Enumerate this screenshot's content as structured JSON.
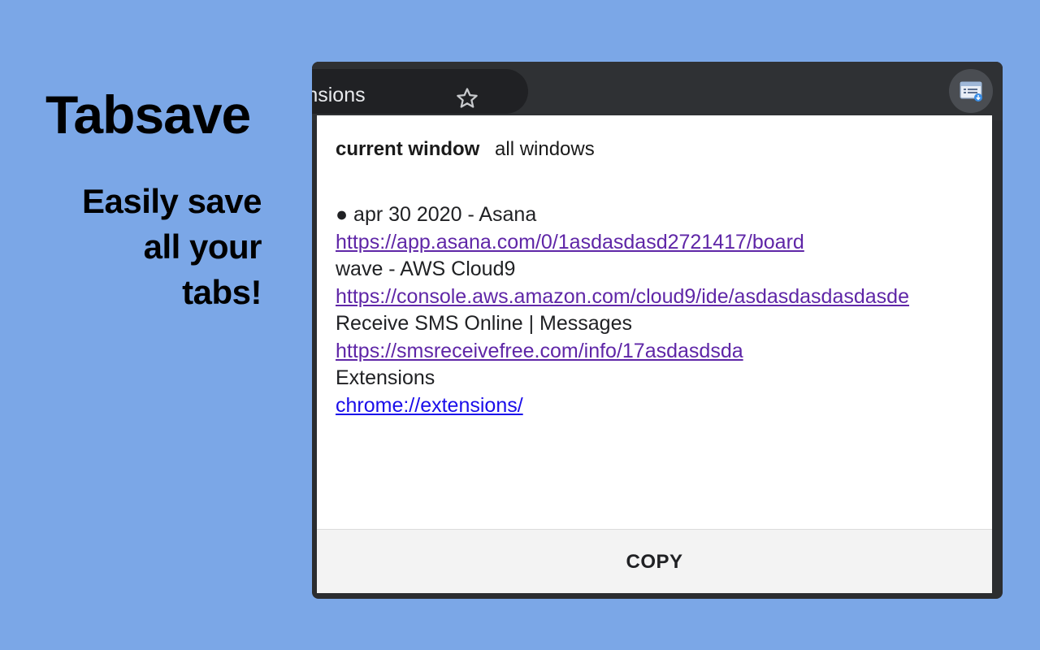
{
  "promo": {
    "title": "Tabsave",
    "tagline_lines": [
      "Easily save",
      "all your",
      "tabs!"
    ]
  },
  "browser": {
    "tab_title": "Extensions",
    "tab_title_visible": "xtensions",
    "icons": {
      "bookmark": "star-icon",
      "extension": "tabsave-extension-icon"
    }
  },
  "popup": {
    "tabs": {
      "current": "current window",
      "all": "all windows"
    },
    "date_header": "● apr 30 2020 - Asana",
    "saved_tabs": [
      {
        "title": "apr 30 2020 - Asana",
        "url": "https://app.asana.com/0/1asdasdasd2721417/board"
      },
      {
        "title": "wave - AWS Cloud9",
        "url": "https://console.aws.amazon.com/cloud9/ide/asdasdasdasdasde"
      },
      {
        "title": "Receive SMS Online | Messages",
        "url": "https://smsreceivefree.com/info/17asdasdsda"
      },
      {
        "title": "Extensions",
        "url": "chrome://extensions/"
      }
    ],
    "copy_label": "COPY"
  },
  "colors": {
    "background": "#7ba7e7",
    "visited_link": "#5f26a7",
    "unvisited_link": "#1a0dea",
    "toolbar": "#2f3134"
  }
}
